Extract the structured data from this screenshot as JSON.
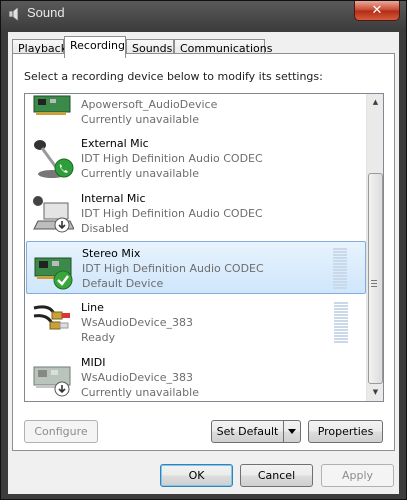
{
  "window": {
    "title": "Sound",
    "close_glyph": "✕"
  },
  "tabs": [
    {
      "label": "Playback",
      "active": false
    },
    {
      "label": "Recording",
      "active": true
    },
    {
      "label": "Sounds",
      "active": false
    },
    {
      "label": "Communications",
      "active": false
    }
  ],
  "instruction": "Select a recording device below to modify its settings:",
  "devices": [
    {
      "name": "",
      "description": "Apowersoft_AudioDevice",
      "status": "Currently unavailable",
      "icon": "sound-card-icon",
      "badge": "disabled-arrow-icon",
      "selected": false,
      "meter": false
    },
    {
      "name": "External Mic",
      "description": "IDT High Definition Audio CODEC",
      "status": "Currently unavailable",
      "icon": "microphone-icon",
      "badge": "phone-icon",
      "selected": false,
      "meter": false
    },
    {
      "name": "Internal Mic",
      "description": "IDT High Definition Audio CODEC",
      "status": "Disabled",
      "icon": "laptop-mic-icon",
      "badge": "disabled-arrow-icon",
      "selected": false,
      "meter": false
    },
    {
      "name": "Stereo Mix",
      "description": "IDT High Definition Audio CODEC",
      "status": "Default Device",
      "icon": "sound-card-icon",
      "badge": "check-icon",
      "selected": true,
      "meter": true
    },
    {
      "name": "Line",
      "description": "WsAudioDevice_383",
      "status": "Ready",
      "icon": "rca-cable-icon",
      "badge": "",
      "selected": false,
      "meter": true
    },
    {
      "name": "MIDI",
      "description": "WsAudioDevice_383",
      "status": "Currently unavailable",
      "icon": "sound-card-icon",
      "badge": "disabled-arrow-icon",
      "selected": false,
      "meter": false
    }
  ],
  "buttons": {
    "configure": "Configure",
    "set_default": "Set Default",
    "properties": "Properties",
    "ok": "OK",
    "cancel": "Cancel",
    "apply": "Apply"
  },
  "colors": {
    "selection": "#cfe6fc",
    "selection_border": "#84acdd",
    "check_badge": "#3aa53a",
    "phone_badge": "#2e9e3a"
  }
}
